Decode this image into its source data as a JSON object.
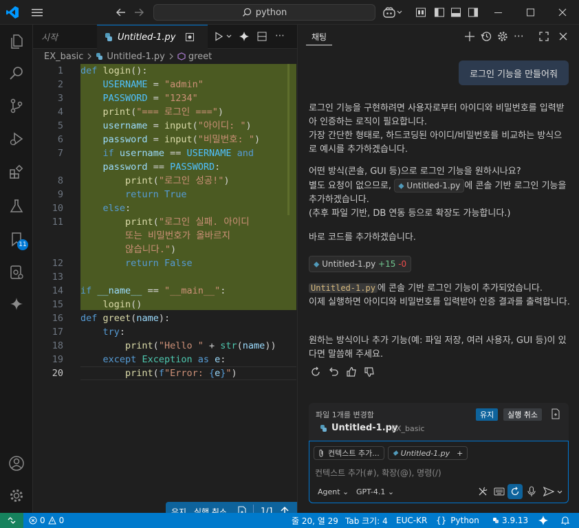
{
  "titlebar": {
    "search_text": "python"
  },
  "activity": {
    "badge": "11"
  },
  "tabs": [
    {
      "label": "시작"
    },
    {
      "label": "Untitled-1.py"
    }
  ],
  "breadcrumb": {
    "folder": "EX_basic",
    "file": "Untitled-1.py",
    "symbol": "greet"
  },
  "code_lines": [
    {
      "n": "1",
      "html": "<span class='kw'>def</span> <span class='fn'>login</span><span class='pl'>():</span>"
    },
    {
      "n": "2",
      "html": "    <span class='cn'>USERNAME</span> <span class='pl'>=</span> <span class='str'>\"admin\"</span>"
    },
    {
      "n": "3",
      "html": "    <span class='cn'>PASSWORD</span> <span class='pl'>=</span> <span class='str'>\"1234\"</span>"
    },
    {
      "n": "4",
      "html": "    <span class='fn'>print</span><span class='pl'>(</span><span class='str'>\"=== 로그인 ===\"</span><span class='pl'>)</span>"
    },
    {
      "n": "5",
      "html": "    <span class='id'>username</span> <span class='pl'>=</span> <span class='fn'>input</span><span class='pl'>(</span><span class='str'>\"아이디: \"</span><span class='pl'>)</span>"
    },
    {
      "n": "6",
      "html": "    <span class='id'>password</span> <span class='pl'>=</span> <span class='fn'>input</span><span class='pl'>(</span><span class='str'>\"비밀번호: \"</span><span class='pl'>)</span>"
    },
    {
      "n": "7",
      "html": "    <span class='kw'>if</span> <span class='id'>username</span> <span class='pl'>==</span> <span class='cn'>USERNAME</span> <span class='kw'>and</span>"
    },
    {
      "n": "",
      "html": "    <span class='id'>password</span> <span class='pl'>==</span> <span class='cn'>PASSWORD</span><span class='pl'>:</span>"
    },
    {
      "n": "8",
      "html": "        <span class='fn'>print</span><span class='pl'>(</span><span class='str'>\"로그인 성공!\"</span><span class='pl'>)</span>"
    },
    {
      "n": "9",
      "html": "        <span class='kw'>return</span> <span class='kw'>True</span>"
    },
    {
      "n": "10",
      "html": "    <span class='kw'>else</span><span class='pl'>:</span>"
    },
    {
      "n": "11",
      "html": "        <span class='fn'>print</span><span class='pl'>(</span><span class='str'>\"로그인 실패. 아이디</span>"
    },
    {
      "n": "",
      "html": "        <span class='str'>또는 비밀번호가 올바르지</span>"
    },
    {
      "n": "",
      "html": "        <span class='str'>않습니다.\"</span><span class='pl'>)</span>"
    },
    {
      "n": "12",
      "html": "        <span class='kw'>return</span> <span class='kw'>False</span>"
    },
    {
      "n": "13",
      "html": ""
    },
    {
      "n": "14",
      "html": "<span class='kw'>if</span> <span class='id'>__name__</span> <span class='pl'>==</span> <span class='str'>\"__main__\"</span><span class='pl'>:</span>"
    },
    {
      "n": "15",
      "html": "    <span class='fn'>login</span><span class='pl'>()</span>"
    },
    {
      "n": "16",
      "html": "<span class='kw'>def</span> <span class='fn'>greet</span><span class='pl'>(</span><span class='id'>name</span><span class='pl'>):</span>"
    },
    {
      "n": "17",
      "html": "    <span class='kw'>try</span><span class='pl'>:</span>"
    },
    {
      "n": "18",
      "html": "        <span class='fn'>print</span><span class='pl'>(</span><span class='str'>\"Hello \"</span> <span class='pl'>+</span> <span class='cls'>str</span><span class='pl'>(</span><span class='id'>name</span><span class='pl'>))</span>"
    },
    {
      "n": "19",
      "html": "    <span class='kw'>except</span> <span class='cls'>Exception</span> <span class='kw'>as</span> <span class='id'>e</span><span class='pl'>:</span>"
    },
    {
      "n": "20",
      "html": "        <span class='fn'>print</span><span class='pl'>(</span><span class='kw'>f</span><span class='str'>\"Error: </span><span class='kw'>{</span><span class='id'>e</span><span class='kw'>}</span><span class='str'>\"</span><span class='pl'>)</span>"
    }
  ],
  "editor_actions": {
    "keep": "유지",
    "undo": "실행 취소",
    "pager": "1/1"
  },
  "chat": {
    "title": "채팅",
    "user_message": "로그인 기능을 만들어줘",
    "p1": "로그인 기능을 구현하려면 사용자로부터 아이디와 비밀번호를 입력받아 인증하는 로직이 필요합니다.",
    "p2": "가장 간단한 형태로, 하드코딩된 아이디/비밀번호를 비교하는 방식으로 예시를 추가하겠습니다.",
    "p3": "어떤 방식(콘솔, GUI 등)으로 로그인 기능을 원하시나요?",
    "p4a": "별도 요청이 없으므로,",
    "p4chip": "Untitled-1.py",
    "p4b": "에 콘솔 기반 로그인 기능을 추가하겠습니다.",
    "p5": "(추후 파일 기반, DB 연동 등으로 확장도 가능합니다.)",
    "p6": "바로 코드를 추가하겠습니다.",
    "edit_file": "Untitled-1.py",
    "edit_added": "+15",
    "edit_removed": "-0",
    "p7code": "Untitled-1.py",
    "p7": "에 콘솔 기반 로그인 기능이 추가되었습니다.",
    "p8": "이제 실행하면 아이디와 비밀번호를 입력받아 인증 결과를 출력합니다.",
    "p9": "원하는 방식이나 추가 기능(예: 파일 저장, 여러 사용자, GUI 등)이 있다면 말씀해 주세요.",
    "changed_label": "파일 1개를 변경함",
    "keep": "유지",
    "undo": "실행 취소",
    "changed_file": "Untitled-1.py",
    "changed_folder": "EX_basic",
    "context_chip": "컨텍스트 추가...",
    "file_chip": "Untitled-1.py",
    "input_placeholder": "컨텍스트 추가(#), 확장(@), 명령(/)",
    "mode": "Agent",
    "model": "GPT-4.1"
  },
  "status": {
    "errors": "0",
    "warnings": "0",
    "position": "줄 20, 열 29",
    "tab_size": "Tab 크기: 4",
    "encoding": "EUC-KR",
    "language": "Python",
    "version": "3.9.13"
  },
  "colors": {
    "accent": "#007acc",
    "highlight": "#4b5a22",
    "vscode_blue": "#0078d4"
  }
}
